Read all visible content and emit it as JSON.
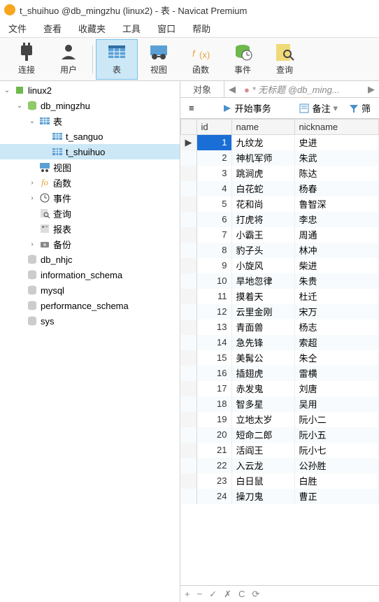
{
  "title": "t_shuihuo @db_mingzhu (linux2) - 表 - Navicat Premium",
  "menu": [
    "文件",
    "查看",
    "收藏夹",
    "工具",
    "窗口",
    "帮助"
  ],
  "toolbar": [
    {
      "label": "连接",
      "icon": "plug"
    },
    {
      "label": "用户",
      "icon": "user"
    },
    {
      "label": "表",
      "icon": "table",
      "active": true
    },
    {
      "label": "视图",
      "icon": "view"
    },
    {
      "label": "函数",
      "icon": "fx"
    },
    {
      "label": "事件",
      "icon": "event"
    },
    {
      "label": "查询",
      "icon": "query"
    }
  ],
  "tree": [
    {
      "d": 0,
      "exp": "v",
      "icon": "conn",
      "label": "linux2"
    },
    {
      "d": 1,
      "exp": "v",
      "icon": "db",
      "label": "db_mingzhu"
    },
    {
      "d": 2,
      "exp": "v",
      "icon": "tblgrp",
      "label": "表"
    },
    {
      "d": 3,
      "exp": "",
      "icon": "tbl",
      "label": "t_sanguo"
    },
    {
      "d": 3,
      "exp": "",
      "icon": "tbl",
      "label": "t_shuihuo",
      "selected": true
    },
    {
      "d": 2,
      "exp": "",
      "icon": "view",
      "label": "视图"
    },
    {
      "d": 2,
      "exp": ">",
      "icon": "fx",
      "label": "函数"
    },
    {
      "d": 2,
      "exp": ">",
      "icon": "evt",
      "label": "事件"
    },
    {
      "d": 2,
      "exp": "",
      "icon": "qry",
      "label": "查询"
    },
    {
      "d": 2,
      "exp": "",
      "icon": "rpt",
      "label": "报表"
    },
    {
      "d": 2,
      "exp": ">",
      "icon": "bak",
      "label": "备份"
    },
    {
      "d": 1,
      "exp": "",
      "icon": "dbg",
      "label": "db_nhjc"
    },
    {
      "d": 1,
      "exp": "",
      "icon": "dbg",
      "label": "information_schema"
    },
    {
      "d": 1,
      "exp": "",
      "icon": "dbg",
      "label": "mysql"
    },
    {
      "d": 1,
      "exp": "",
      "icon": "dbg",
      "label": "performance_schema"
    },
    {
      "d": 1,
      "exp": "",
      "icon": "dbg",
      "label": "sys"
    }
  ],
  "tabs": {
    "obj": "对象",
    "crumb": "* 无标题 @db_ming..."
  },
  "actions": {
    "menu": "≡",
    "start": "开始事务",
    "note": "备注",
    "filter": "筛"
  },
  "columns": [
    "id",
    "name",
    "nickname"
  ],
  "rows": [
    {
      "id": 1,
      "name": "九纹龙",
      "nickname": "史进",
      "sel": true
    },
    {
      "id": 2,
      "name": "神机军师",
      "nickname": "朱武"
    },
    {
      "id": 3,
      "name": "跳涧虎",
      "nickname": "陈达"
    },
    {
      "id": 4,
      "name": "白花蛇",
      "nickname": "杨春"
    },
    {
      "id": 5,
      "name": "花和尚",
      "nickname": "鲁智深"
    },
    {
      "id": 6,
      "name": "打虎将",
      "nickname": "李忠"
    },
    {
      "id": 7,
      "name": "小霸王",
      "nickname": "周通"
    },
    {
      "id": 8,
      "name": "豹子头",
      "nickname": "林冲"
    },
    {
      "id": 9,
      "name": "小旋风",
      "nickname": "柴进"
    },
    {
      "id": 10,
      "name": "旱地忽律",
      "nickname": "朱贵"
    },
    {
      "id": 11,
      "name": "摸着天",
      "nickname": "杜迁"
    },
    {
      "id": 12,
      "name": "云里金刚",
      "nickname": "宋万"
    },
    {
      "id": 13,
      "name": "青面兽",
      "nickname": "杨志"
    },
    {
      "id": 14,
      "name": "急先锋",
      "nickname": "索超"
    },
    {
      "id": 15,
      "name": "美髯公",
      "nickname": "朱仝"
    },
    {
      "id": 16,
      "name": "插翅虎",
      "nickname": "雷横"
    },
    {
      "id": 17,
      "name": "赤发鬼",
      "nickname": "刘唐"
    },
    {
      "id": 18,
      "name": "智多星",
      "nickname": "吴用"
    },
    {
      "id": 19,
      "name": "立地太岁",
      "nickname": "阮小二"
    },
    {
      "id": 20,
      "name": "短命二郎",
      "nickname": "阮小五"
    },
    {
      "id": 21,
      "name": "活阎王",
      "nickname": "阮小七"
    },
    {
      "id": 22,
      "name": "入云龙",
      "nickname": "公孙胜"
    },
    {
      "id": 23,
      "name": "白日鼠",
      "nickname": "白胜"
    },
    {
      "id": 24,
      "name": "操刀鬼",
      "nickname": "曹正"
    }
  ],
  "status": [
    "+",
    "−",
    "✓",
    "✗",
    "C",
    "⟳"
  ]
}
